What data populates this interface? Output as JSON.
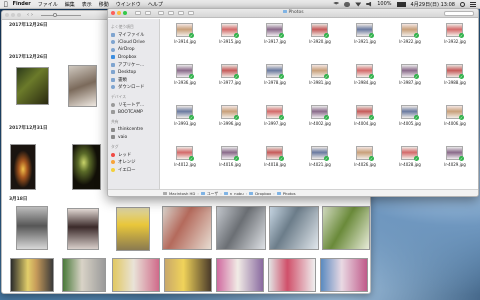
{
  "menubar": {
    "apple": "",
    "app_name": "Finder",
    "items": [
      "ファイル",
      "編集",
      "表示",
      "移動",
      "ウインドウ",
      "ヘルプ"
    ],
    "battery": "100%",
    "clock": "4月29日(日) 13:08"
  },
  "photo_window": {
    "dates": [
      "2017年12月26日",
      "2017年12月26日",
      "2017年12月31日",
      "3月18日"
    ]
  },
  "finder": {
    "title": "Photos",
    "sidebar": {
      "favorites_header": "よく使う項目",
      "favorites": [
        "マイファイル",
        "iCloud Drive",
        "AirDrop",
        "Dropbox",
        "アプリケー...",
        "Desktop",
        "書類",
        "ダウンロード"
      ],
      "devices_header": "デバイス",
      "devices": [
        "リモートデ...",
        "BOOTCAMP"
      ],
      "shared_header": "共有",
      "shared": [
        "thinkcentre",
        "vaio"
      ],
      "tags_header": "タグ",
      "tags": [
        {
          "label": "レッド",
          "color": "#f04b45"
        },
        {
          "label": "オレンジ",
          "color": "#f7a33a"
        },
        {
          "label": "イエロー",
          "color": "#f3d03b"
        }
      ]
    },
    "files": [
      [
        "lr-3914.jpg",
        "lr-3915.jpg",
        "lr-3917.jpg",
        "lr-3920.jpg",
        "lr-3921.jpg",
        "lr-3922.jpg",
        "lr-3932.jpg"
      ],
      [
        "lr-3936.jpg",
        "lr-3977.jpg",
        "lr-3978.jpg",
        "lr-3981.jpg",
        "lr-3984.jpg",
        "lr-3987.jpg",
        "lr-3988.jpg"
      ],
      [
        "lr-3993.jpg",
        "lr-3996.jpg",
        "lr-3997.jpg",
        "lr-4002.jpg",
        "lr-4004.jpg",
        "lr-4005.jpg",
        "lr-4006.jpg"
      ],
      [
        "lr-4012.jpg",
        "lr-4016.jpg",
        "lr-4018.jpg",
        "lr-4021.jpg",
        "lr-4026.jpg",
        "lr-4028.jpg",
        "lr-4029.jpg"
      ]
    ],
    "pathbar": [
      "Macintosh HD",
      "ユーザ",
      "n",
      "nobu",
      "Dropbox",
      "Photos"
    ]
  }
}
